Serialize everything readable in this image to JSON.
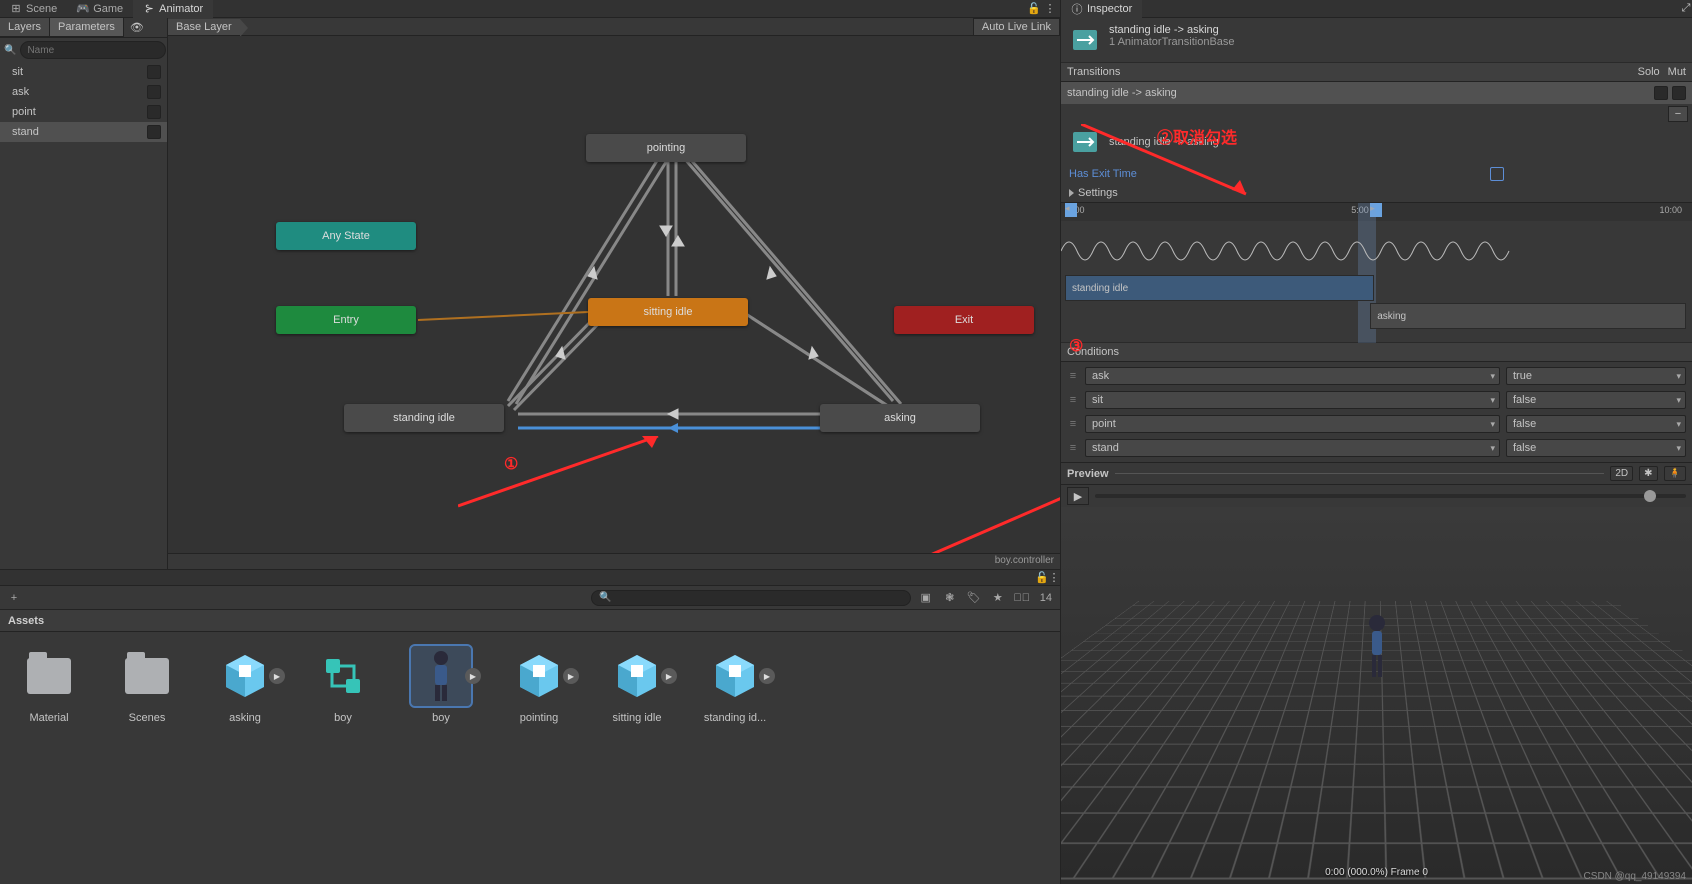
{
  "topTabs": {
    "scene": "Scene",
    "game": "Game",
    "animator": "Animator"
  },
  "animLeft": {
    "layers": "Layers",
    "parameters": "Parameters",
    "searchPlaceholder": "Name"
  },
  "breadcrumb": "Base Layer",
  "autoLive": "Auto Live Link",
  "params": [
    {
      "name": "sit"
    },
    {
      "name": "ask"
    },
    {
      "name": "point"
    },
    {
      "name": "stand"
    }
  ],
  "nodes": {
    "pointing": "pointing",
    "sitting": "sitting idle",
    "standing": "standing idle",
    "asking": "asking",
    "any": "Any State",
    "entry": "Entry",
    "exit": "Exit"
  },
  "footerPath": "boy.controller",
  "project": {
    "header": "Assets",
    "hidden": "14",
    "searchPlaceholder": ""
  },
  "assets": [
    {
      "label": "Material",
      "type": "folder"
    },
    {
      "label": "Scenes",
      "type": "folder"
    },
    {
      "label": "asking",
      "type": "clip"
    },
    {
      "label": "boy",
      "type": "ctrl"
    },
    {
      "label": "boy",
      "type": "avatar",
      "sel": true
    },
    {
      "label": "pointing",
      "type": "clip"
    },
    {
      "label": "sitting idle",
      "type": "clip"
    },
    {
      "label": "standing id...",
      "type": "clip"
    }
  ],
  "inspector": {
    "tab": "Inspector",
    "title": "standing idle -> asking",
    "sub": "1 AnimatorTransitionBase",
    "transHdr": "Transitions",
    "solo": "Solo",
    "mute": "Mut",
    "transItem": "standing idle -> asking",
    "detail": "standing idle -> asking",
    "hasExit": "Has Exit Time",
    "settings": "Settings",
    "tl": {
      "t0": "0:00",
      "t1": "5:00",
      "t2": "10:00",
      "clip1": "standing idle",
      "clip2": "asking"
    },
    "condHdr": "Conditions",
    "conds": [
      {
        "p": "ask",
        "v": "true"
      },
      {
        "p": "sit",
        "v": "false"
      },
      {
        "p": "point",
        "v": "false"
      },
      {
        "p": "stand",
        "v": "false"
      }
    ],
    "preview": {
      "label": "Preview",
      "btn2d": "2D",
      "status": "0:00 (000.0%) Frame 0"
    }
  },
  "anno": {
    "n1": "①",
    "n2": "②取消勾选",
    "n3": "③"
  },
  "watermark": "CSDN @qq_49149394"
}
